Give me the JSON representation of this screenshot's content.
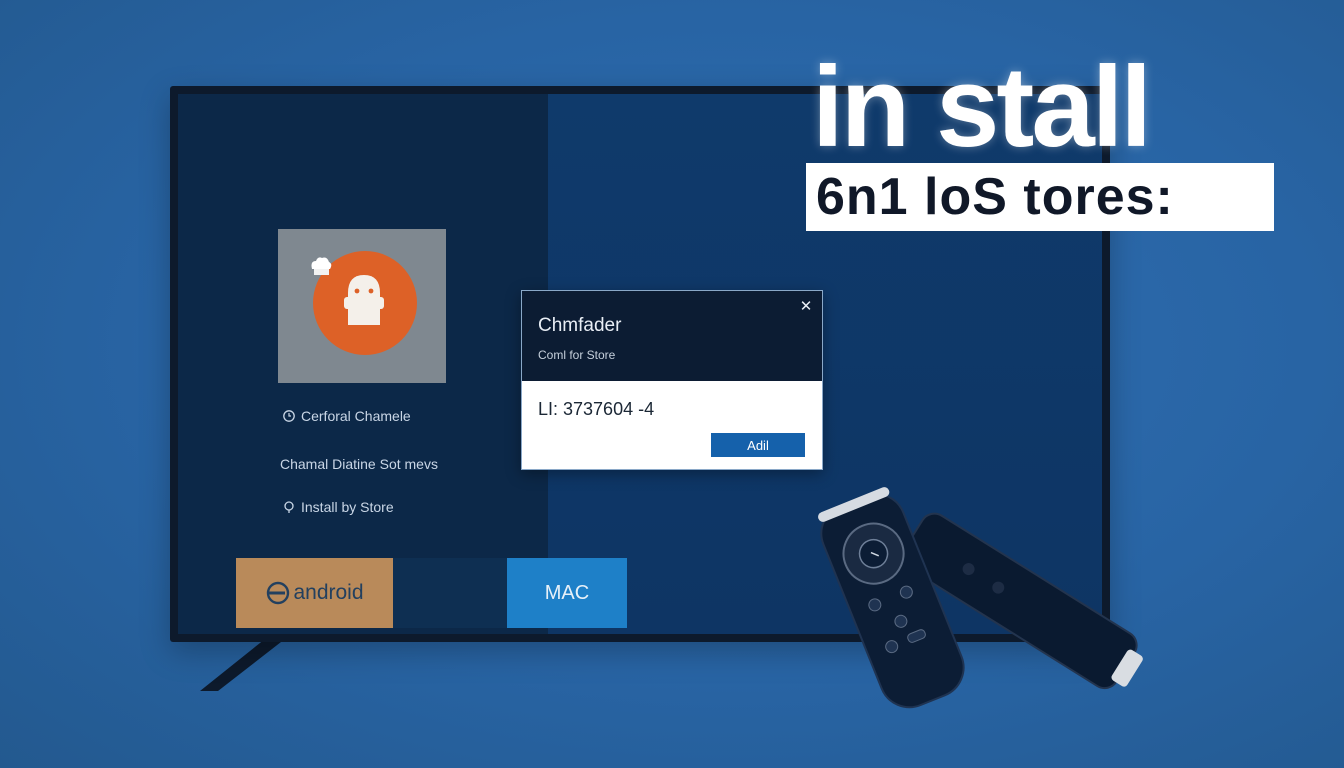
{
  "headline": {
    "line1": "in stall",
    "line2": "6n1 loS tores:"
  },
  "sidebar": {
    "items": [
      {
        "label": "Cerforal Chamele",
        "icon": "refresh-icon"
      },
      {
        "label": "Chamal Diatine Sot mevs",
        "icon": ""
      },
      {
        "label": "Install by Store",
        "icon": "pin-icon"
      }
    ]
  },
  "tiles": {
    "android": "android",
    "mac": "MAC"
  },
  "dialog": {
    "title": "Chmfader",
    "subtitle": "Coml for Store",
    "close": "✕",
    "field": "LI:  3737604 -4",
    "button": "Adil"
  },
  "colors": {
    "background": "#2a66a6",
    "app_icon": "#dd6127",
    "android_tile": "#b98a5a",
    "mac_tile": "#1e80c8",
    "dialog_button": "#1561ab"
  }
}
